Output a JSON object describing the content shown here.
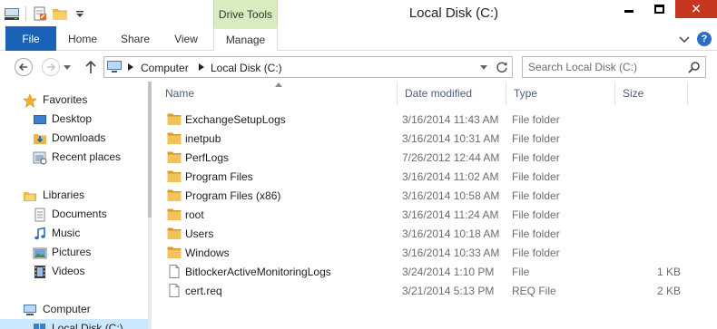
{
  "window": {
    "title": "Local Disk (C:)",
    "context_tab_group": "Drive Tools"
  },
  "ribbon": {
    "tabs": [
      "File",
      "Home",
      "Share",
      "View",
      "Manage"
    ]
  },
  "address_bar": {
    "crumbs": [
      "Computer",
      "Local Disk (C:)"
    ]
  },
  "search": {
    "placeholder": "Search Local Disk (C:)"
  },
  "nav_pane": {
    "favorites_label": "Favorites",
    "favorites": [
      "Desktop",
      "Downloads",
      "Recent places"
    ],
    "libraries_label": "Libraries",
    "libraries": [
      "Documents",
      "Music",
      "Pictures",
      "Videos"
    ],
    "computer_label": "Computer",
    "selected_drive": "Local Disk (C:)"
  },
  "columns": [
    "Name",
    "Date modified",
    "Type",
    "Size"
  ],
  "files": [
    {
      "name": "ExchangeSetupLogs",
      "date": "3/16/2014 11:43 AM",
      "type": "File folder",
      "size": "",
      "kind": "folder"
    },
    {
      "name": "inetpub",
      "date": "3/16/2014 10:31 AM",
      "type": "File folder",
      "size": "",
      "kind": "folder"
    },
    {
      "name": "PerfLogs",
      "date": "7/26/2012 12:44 AM",
      "type": "File folder",
      "size": "",
      "kind": "folder"
    },
    {
      "name": "Program Files",
      "date": "3/16/2014 11:02 AM",
      "type": "File folder",
      "size": "",
      "kind": "folder"
    },
    {
      "name": "Program Files (x86)",
      "date": "3/16/2014 10:58 AM",
      "type": "File folder",
      "size": "",
      "kind": "folder"
    },
    {
      "name": "root",
      "date": "3/16/2014 11:24 AM",
      "type": "File folder",
      "size": "",
      "kind": "folder"
    },
    {
      "name": "Users",
      "date": "3/16/2014 10:18 AM",
      "type": "File folder",
      "size": "",
      "kind": "folder"
    },
    {
      "name": "Windows",
      "date": "3/16/2014 10:33 AM",
      "type": "File folder",
      "size": "",
      "kind": "folder"
    },
    {
      "name": "BitlockerActiveMonitoringLogs",
      "date": "3/24/2014 1:10 PM",
      "type": "File",
      "size": "1 KB",
      "kind": "file"
    },
    {
      "name": "cert.req",
      "date": "3/21/2014 5:13 PM",
      "type": "REQ File",
      "size": "2 KB",
      "kind": "file"
    }
  ],
  "colors": {
    "file_tab": "#1a62b7",
    "context_tab": "#d9ecc0",
    "close_button": "#c7361e",
    "folder": "#e8b74a",
    "selection": "#cce8ff",
    "header_text": "#4c607a"
  }
}
